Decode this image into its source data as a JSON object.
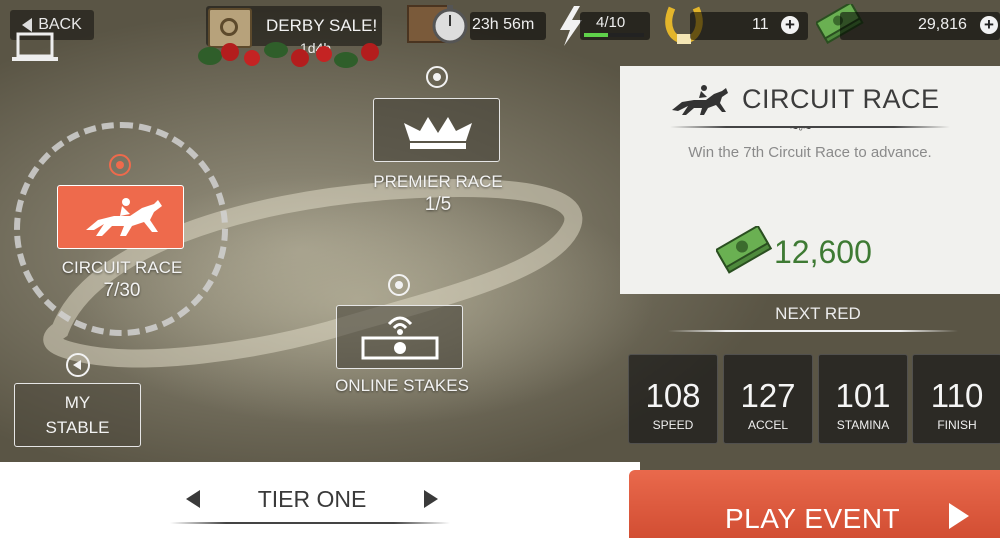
{
  "header": {
    "back_label": "BACK",
    "sale_title": "DERBY SALE!",
    "sale_time": "1d4h",
    "timer": "23h 56m",
    "energy": "4/10",
    "energy_fraction": 0.4,
    "horseshoes": "11",
    "cash": "29,816"
  },
  "map": {
    "circuit": {
      "label": "CIRCUIT RACE",
      "progress": "7/30"
    },
    "premier": {
      "label": "PREMIER RACE",
      "progress": "1/5"
    },
    "online": {
      "label": "ONLINE STAKES"
    },
    "stable": {
      "line1": "MY",
      "line2": "STABLE"
    }
  },
  "panel": {
    "title": "CIRCUIT RACE",
    "description": "Win the 7th Circuit Race to advance.",
    "reward": "12,600",
    "next_label": "NEXT RED",
    "stats": [
      {
        "value": "108",
        "name": "SPEED"
      },
      {
        "value": "127",
        "name": "ACCEL"
      },
      {
        "value": "101",
        "name": "STAMINA"
      },
      {
        "value": "110",
        "name": "FINISH"
      }
    ]
  },
  "footer": {
    "tier_label": "TIER ONE",
    "play_label": "PLAY EVENT"
  },
  "colors": {
    "accent": "#ee6a4c",
    "reward_green": "#3e7a33",
    "energy_green": "#5fd14a"
  }
}
